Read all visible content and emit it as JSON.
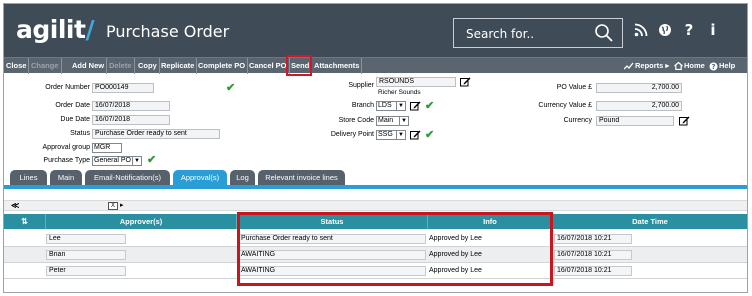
{
  "header": {
    "logo_text": "agilit",
    "logo_slash": "/",
    "title": "Purchase Order",
    "search_placeholder": "Search for..",
    "icons": [
      "search-icon",
      "rss-icon",
      "globe-icon",
      "help-icon",
      "info-icon"
    ],
    "icon_glyphs": {
      "rss": "ⲁ",
      "globe": "●",
      "help": "?",
      "info": "i"
    },
    "bg_color": "#3f4b57",
    "accent_color": "#2a9dd6"
  },
  "toolbar": {
    "buttons": [
      {
        "label": "Close",
        "disabled": false
      },
      {
        "label": "Change",
        "disabled": true
      },
      {
        "label": "Add New",
        "disabled": false
      },
      {
        "label": "Delete",
        "disabled": true
      },
      {
        "label": "Copy",
        "disabled": false
      },
      {
        "label": "Replicate",
        "disabled": false
      },
      {
        "label": "Complete PO",
        "disabled": false
      },
      {
        "label": "Cancel PO",
        "disabled": false
      },
      {
        "label": "Send",
        "disabled": false,
        "highlighted": true
      },
      {
        "label": "Attachments",
        "disabled": false
      }
    ],
    "reports_label": "Reports ▸",
    "home_label": "Home",
    "help_label": "Help"
  },
  "form": {
    "order_number": {
      "label": "Order Number",
      "value": "PO000149"
    },
    "order_date": {
      "label": "Order Date",
      "value": "16/07/2018"
    },
    "due_date": {
      "label": "Due Date",
      "value": "16/07/2018"
    },
    "status": {
      "label": "Status",
      "value": "Purchase Order ready to sent"
    },
    "approval_group": {
      "label": "Approval group",
      "value": "MGR"
    },
    "purchase_type": {
      "label": "Purchase Type",
      "value": "General PO"
    },
    "supplier": {
      "label": "Supplier",
      "value": "RSOUNDS",
      "subtext": "Richer Sounds"
    },
    "branch": {
      "label": "Branch",
      "value": "LDS"
    },
    "store_code": {
      "label": "Store Code",
      "value": "Main"
    },
    "delivery_point": {
      "label": "Delivery Point",
      "value": "SSG"
    },
    "po_value": {
      "label": "PO Value",
      "currency_symbol": "£",
      "value": "2,700.00"
    },
    "currency_value": {
      "label": "Currency Value",
      "currency_symbol": "£",
      "value": "2,700.00"
    },
    "currency": {
      "label": "Currency",
      "value": "Pound"
    }
  },
  "tabs": [
    {
      "label": "Lines",
      "active": false
    },
    {
      "label": "Main",
      "active": false
    },
    {
      "label": "Email-Notification(s)",
      "active": false
    },
    {
      "label": "Approval(s)",
      "active": true
    },
    {
      "label": "Log",
      "active": false
    },
    {
      "label": "Relevant invoice lines",
      "active": false
    }
  ],
  "grid": {
    "toolbar": {
      "collapse_glyph": "≪",
      "export_glyph": "X",
      "more_glyph": "▸"
    },
    "columns": [
      "Approver(s)",
      "Status",
      "Info",
      "Date Time"
    ],
    "sort_glyph": "⇅",
    "rows": [
      {
        "approver": "Lee",
        "status": "Purchase Order ready to sent",
        "info": "Approved by Lee",
        "datetime": "16/07/2018 10:21"
      },
      {
        "approver": "Brian",
        "status": "AWAITING",
        "info": "Approved by Lee",
        "datetime": "16/07/2018 10:21"
      },
      {
        "approver": "Peter",
        "status": "AWAITING",
        "info": "Approved by Lee",
        "datetime": "16/07/2018 10:21"
      }
    ]
  }
}
